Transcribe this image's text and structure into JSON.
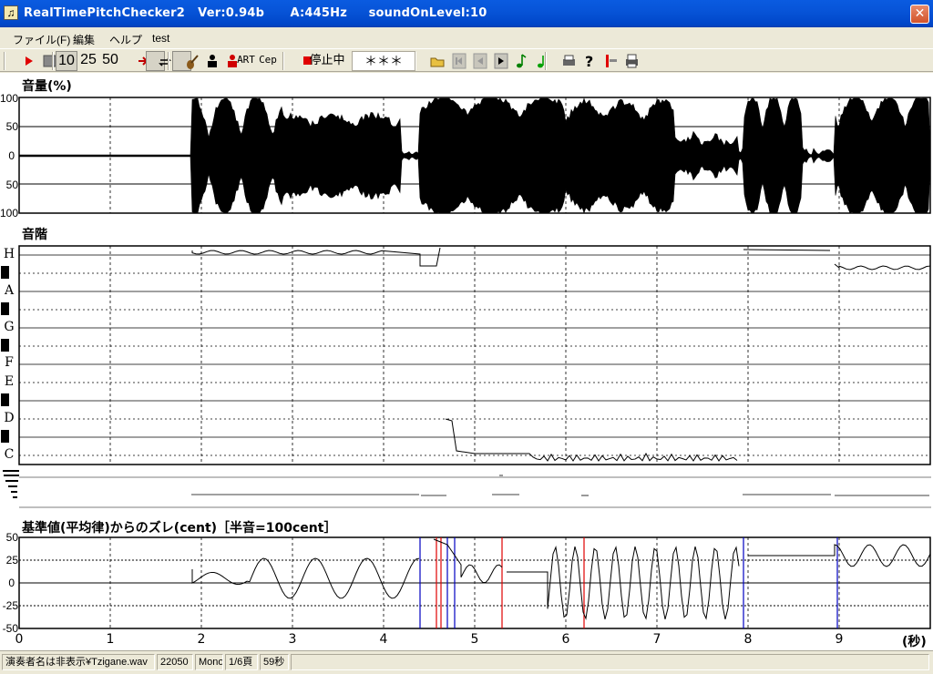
{
  "window": {
    "title": "RealTimePitchChecker2   Ver:0.94b      A:445Hz     soundOnLevel:10",
    "close_glyph": "✕"
  },
  "menu": [
    "ファイル(F)",
    "編集",
    "ヘルプ",
    "test"
  ],
  "toolbar": {
    "zoom_buttons": [
      "10",
      "25",
      "50"
    ],
    "art_label": "ART",
    "cep_label": "Cep",
    "status_label": "停止中",
    "note_display": "＊＊＊",
    "icons": [
      "play-icon",
      "stop-icon",
      "skip-to-end-icon",
      "loop-icon",
      "violin-icon",
      "person-black-icon",
      "person-red-icon",
      "stop-red-icon",
      "open-folder-icon",
      "first-icon",
      "prev-icon",
      "next-icon",
      "note-icon",
      "note-green-icon",
      "print-icon",
      "help-icon",
      "split-icon",
      "printer-icon"
    ]
  },
  "volume_panel": {
    "title": "音量(%)",
    "y_ticks": [
      "100",
      "50",
      "0",
      "50",
      "100"
    ]
  },
  "scale_panel": {
    "title": "音階",
    "notes": [
      "H",
      "A",
      "G",
      "F",
      "E",
      "D",
      "C"
    ]
  },
  "deviation_panel": {
    "title": "基準値(平均律)からのズレ(cent)［半音=100cent］",
    "y_ticks": [
      "50",
      "25",
      "0",
      "-25",
      "-50"
    ]
  },
  "x_axis": {
    "ticks": [
      "0",
      "1",
      "2",
      "3",
      "4",
      "5",
      "6",
      "7",
      "8",
      "9"
    ],
    "unit": "(秒)"
  },
  "status": {
    "file": "演奏者名は非表示¥Tzigane.wav",
    "rate": "22050",
    "channels": "Mono",
    "page": "1/6頁",
    "duration": "59秒"
  },
  "colors": {
    "title_bar": "#0054E3",
    "close": "#D2532B",
    "waveform": "#000000",
    "spike_red": "#E00000",
    "spike_blue": "#0000C0"
  }
}
